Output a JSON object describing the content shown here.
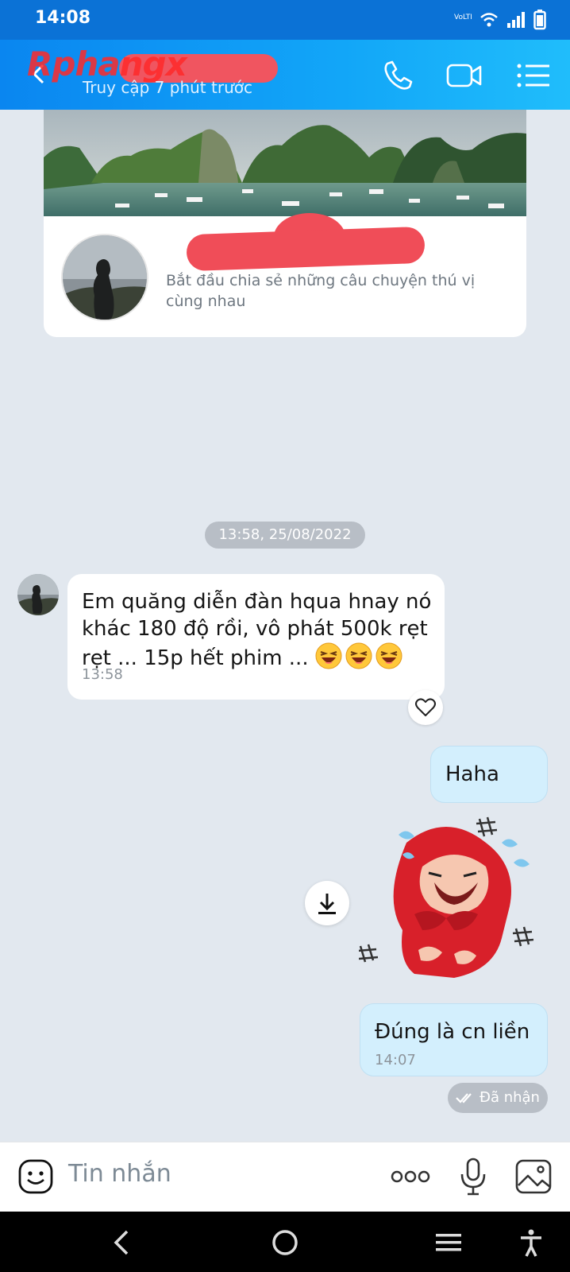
{
  "status_bar": {
    "time": "14:08"
  },
  "header": {
    "watermark": "Rphangx",
    "subtitle": "Truy cập 7 phút trước"
  },
  "profile_card": {
    "description": "Bắt đầu chia sẻ những câu chuyện thú vị cùng nhau"
  },
  "conversation": {
    "date_separator": "13:58, 25/08/2022",
    "messages": [
      {
        "direction": "in",
        "text": "Em quăng diễn đàn hqua hnay nó khác 180 độ rồi, vô phát 500k rẹt rẹt ... 15p hết phim ...",
        "time": "13:58",
        "emoji_count": 3
      },
      {
        "direction": "out",
        "text": "Haha"
      },
      {
        "direction": "out",
        "type": "sticker",
        "sticker": "crying-laughing-girl-red-hood"
      },
      {
        "direction": "out",
        "text": "Đúng là cn liền",
        "time": "14:07"
      }
    ],
    "status": "Đã nhận"
  },
  "input": {
    "placeholder": "Tin nhắn"
  },
  "icons": {
    "call": "phone-icon",
    "video": "video-camera-icon",
    "menu": "list-menu-icon",
    "emoji": "emoji-icon",
    "more": "more-dots-icon",
    "mic": "microphone-icon",
    "image": "image-icon"
  },
  "colors": {
    "header": "#12a6f8",
    "outgoing_bubble": "#d3effd",
    "background": "#e2e8ef"
  }
}
